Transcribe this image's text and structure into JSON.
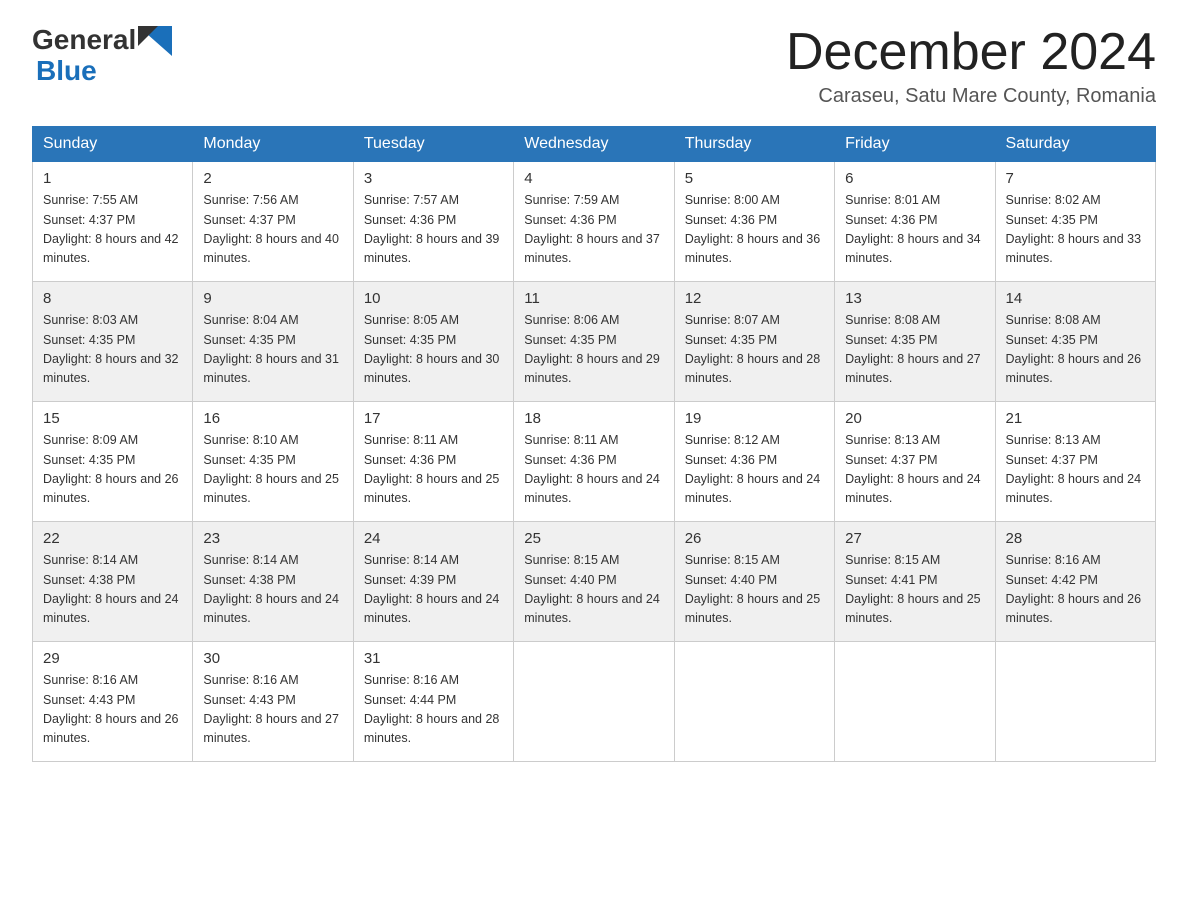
{
  "header": {
    "logo_general": "General",
    "logo_blue": "Blue",
    "month_title": "December 2024",
    "location": "Caraseu, Satu Mare County, Romania"
  },
  "weekdays": [
    "Sunday",
    "Monday",
    "Tuesday",
    "Wednesday",
    "Thursday",
    "Friday",
    "Saturday"
  ],
  "weeks": [
    [
      {
        "day": "1",
        "sunrise": "7:55 AM",
        "sunset": "4:37 PM",
        "daylight": "8 hours and 42 minutes."
      },
      {
        "day": "2",
        "sunrise": "7:56 AM",
        "sunset": "4:37 PM",
        "daylight": "8 hours and 40 minutes."
      },
      {
        "day": "3",
        "sunrise": "7:57 AM",
        "sunset": "4:36 PM",
        "daylight": "8 hours and 39 minutes."
      },
      {
        "day": "4",
        "sunrise": "7:59 AM",
        "sunset": "4:36 PM",
        "daylight": "8 hours and 37 minutes."
      },
      {
        "day": "5",
        "sunrise": "8:00 AM",
        "sunset": "4:36 PM",
        "daylight": "8 hours and 36 minutes."
      },
      {
        "day": "6",
        "sunrise": "8:01 AM",
        "sunset": "4:36 PM",
        "daylight": "8 hours and 34 minutes."
      },
      {
        "day": "7",
        "sunrise": "8:02 AM",
        "sunset": "4:35 PM",
        "daylight": "8 hours and 33 minutes."
      }
    ],
    [
      {
        "day": "8",
        "sunrise": "8:03 AM",
        "sunset": "4:35 PM",
        "daylight": "8 hours and 32 minutes."
      },
      {
        "day": "9",
        "sunrise": "8:04 AM",
        "sunset": "4:35 PM",
        "daylight": "8 hours and 31 minutes."
      },
      {
        "day": "10",
        "sunrise": "8:05 AM",
        "sunset": "4:35 PM",
        "daylight": "8 hours and 30 minutes."
      },
      {
        "day": "11",
        "sunrise": "8:06 AM",
        "sunset": "4:35 PM",
        "daylight": "8 hours and 29 minutes."
      },
      {
        "day": "12",
        "sunrise": "8:07 AM",
        "sunset": "4:35 PM",
        "daylight": "8 hours and 28 minutes."
      },
      {
        "day": "13",
        "sunrise": "8:08 AM",
        "sunset": "4:35 PM",
        "daylight": "8 hours and 27 minutes."
      },
      {
        "day": "14",
        "sunrise": "8:08 AM",
        "sunset": "4:35 PM",
        "daylight": "8 hours and 26 minutes."
      }
    ],
    [
      {
        "day": "15",
        "sunrise": "8:09 AM",
        "sunset": "4:35 PM",
        "daylight": "8 hours and 26 minutes."
      },
      {
        "day": "16",
        "sunrise": "8:10 AM",
        "sunset": "4:35 PM",
        "daylight": "8 hours and 25 minutes."
      },
      {
        "day": "17",
        "sunrise": "8:11 AM",
        "sunset": "4:36 PM",
        "daylight": "8 hours and 25 minutes."
      },
      {
        "day": "18",
        "sunrise": "8:11 AM",
        "sunset": "4:36 PM",
        "daylight": "8 hours and 24 minutes."
      },
      {
        "day": "19",
        "sunrise": "8:12 AM",
        "sunset": "4:36 PM",
        "daylight": "8 hours and 24 minutes."
      },
      {
        "day": "20",
        "sunrise": "8:13 AM",
        "sunset": "4:37 PM",
        "daylight": "8 hours and 24 minutes."
      },
      {
        "day": "21",
        "sunrise": "8:13 AM",
        "sunset": "4:37 PM",
        "daylight": "8 hours and 24 minutes."
      }
    ],
    [
      {
        "day": "22",
        "sunrise": "8:14 AM",
        "sunset": "4:38 PM",
        "daylight": "8 hours and 24 minutes."
      },
      {
        "day": "23",
        "sunrise": "8:14 AM",
        "sunset": "4:38 PM",
        "daylight": "8 hours and 24 minutes."
      },
      {
        "day": "24",
        "sunrise": "8:14 AM",
        "sunset": "4:39 PM",
        "daylight": "8 hours and 24 minutes."
      },
      {
        "day": "25",
        "sunrise": "8:15 AM",
        "sunset": "4:40 PM",
        "daylight": "8 hours and 24 minutes."
      },
      {
        "day": "26",
        "sunrise": "8:15 AM",
        "sunset": "4:40 PM",
        "daylight": "8 hours and 25 minutes."
      },
      {
        "day": "27",
        "sunrise": "8:15 AM",
        "sunset": "4:41 PM",
        "daylight": "8 hours and 25 minutes."
      },
      {
        "day": "28",
        "sunrise": "8:16 AM",
        "sunset": "4:42 PM",
        "daylight": "8 hours and 26 minutes."
      }
    ],
    [
      {
        "day": "29",
        "sunrise": "8:16 AM",
        "sunset": "4:43 PM",
        "daylight": "8 hours and 26 minutes."
      },
      {
        "day": "30",
        "sunrise": "8:16 AM",
        "sunset": "4:43 PM",
        "daylight": "8 hours and 27 minutes."
      },
      {
        "day": "31",
        "sunrise": "8:16 AM",
        "sunset": "4:44 PM",
        "daylight": "8 hours and 28 minutes."
      },
      null,
      null,
      null,
      null
    ]
  ]
}
